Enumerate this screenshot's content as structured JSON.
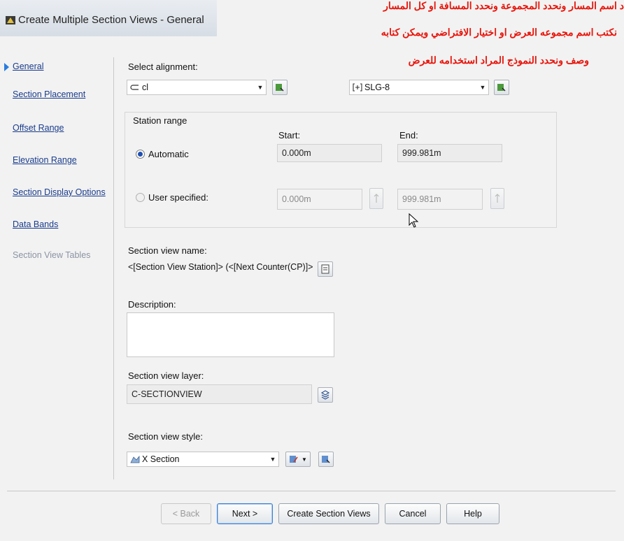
{
  "window": {
    "title": "Create Multiple Section Views - General"
  },
  "overlay": {
    "line1": "د اسم المسار ونحدد المجموعة ونحدد المسافة او كل المسار",
    "line2": "نكتب اسم مجموعه العرض او اختيار الافتراضي ويمكن كتابه",
    "line3": "وصف ونحدد النموذج المراد استخدامه للعرض"
  },
  "nav": {
    "items": [
      {
        "label": "General"
      },
      {
        "label": "Section Placement"
      },
      {
        "label": "Offset Range"
      },
      {
        "label": "Elevation Range"
      },
      {
        "label": "Section Display Options"
      },
      {
        "label": "Data Bands"
      },
      {
        "label": "Section View Tables"
      }
    ]
  },
  "alignment": {
    "label": "Select alignment:",
    "value": "cl",
    "sample_line_group": "SLG-8"
  },
  "station_range": {
    "label": "Station range",
    "start_label": "Start:",
    "end_label": "End:",
    "automatic_label": "Automatic",
    "automatic_start": "0.000m",
    "automatic_end": "999.981m",
    "user_label": "User specified:",
    "user_start": "0.000m",
    "user_end": "999.981m"
  },
  "view_name": {
    "label": "Section view name:",
    "value": "<[Section View Station]> (<[Next Counter(CP)]>"
  },
  "description": {
    "label": "Description:",
    "value": ""
  },
  "layer": {
    "label": "Section view layer:",
    "value": "C-SECTIONVIEW"
  },
  "style": {
    "label": "Section view style:",
    "value": "X Section"
  },
  "buttons": {
    "back": "< Back",
    "next": "Next >",
    "create": "Create Section Views",
    "cancel": "Cancel",
    "help": "Help"
  },
  "colors": {
    "link": "#1a3c8c",
    "overlay_text": "#e8140a",
    "accent": "#2a7be0"
  }
}
